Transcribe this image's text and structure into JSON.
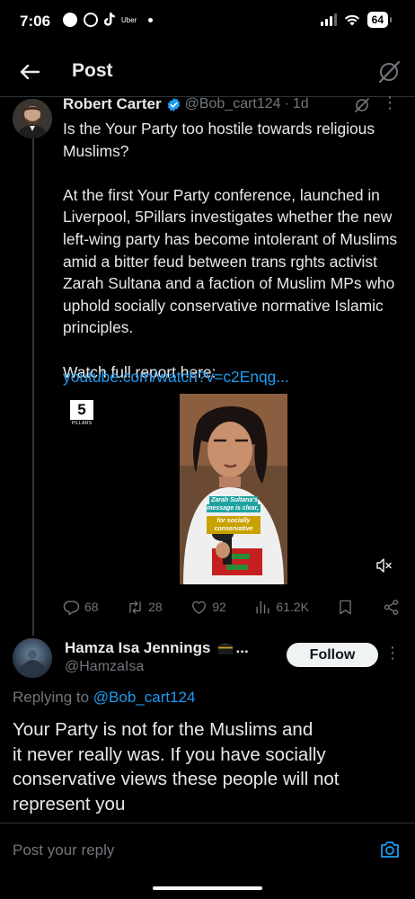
{
  "status_bar": {
    "time": "7:06",
    "uber_label": "Uber",
    "battery": "64"
  },
  "header": {
    "title": "Post"
  },
  "tweet": {
    "author_name": "Robert Carter",
    "handle": "@Bob_cart124",
    "separator": "·",
    "age": "1d",
    "more": "⋮",
    "text": "Is the Your Party too hostile towards religious Muslims?\n\nAt the first Your Party conference, launched in Liverpool, 5Pillars investigates whether the new left-wing party has become intolerant of Muslims amid a bitter feud between trans rghts activist Zarah Sultana and a faction of Muslim MPs who uphold socially conservative normative Islamic principles.\n\nWatch full report here:",
    "link": "youtube.com/watch?v=c2Enqg...",
    "media": {
      "logo_number": "5",
      "logo_text": "PILLARS",
      "caption_line1": "Zarah Sultana's message is clear,",
      "caption_line2": "for socially conservative"
    },
    "stats": {
      "replies": "68",
      "reposts": "28",
      "likes": "92",
      "views": "61.2K"
    }
  },
  "reply": {
    "author_name": "Hamza Isa Jennings",
    "name_suffix": "...",
    "handle": "@HamzaIsa",
    "follow_label": "Follow",
    "more": "⋮",
    "replying_prefix": "Replying to ",
    "replying_to": "@Bob_cart124",
    "text": "Your Party is not for the Muslims and\nit never really was. If you have socially\nconservative views these people will not\nrepresent you"
  },
  "compose": {
    "placeholder": "Post your reply"
  },
  "colors": {
    "background": "#000000",
    "text_primary": "#e7e9ea",
    "text_secondary": "#71767b",
    "accent": "#1d9bf0",
    "divider": "#2f3336"
  },
  "icons": [
    "back-arrow-icon",
    "grok-icon",
    "verified-badge-icon",
    "reply-icon",
    "repost-icon",
    "like-icon",
    "views-icon",
    "bookmark-icon",
    "share-icon",
    "mute-icon",
    "kaaba-emoji-icon",
    "camera-icon"
  ]
}
